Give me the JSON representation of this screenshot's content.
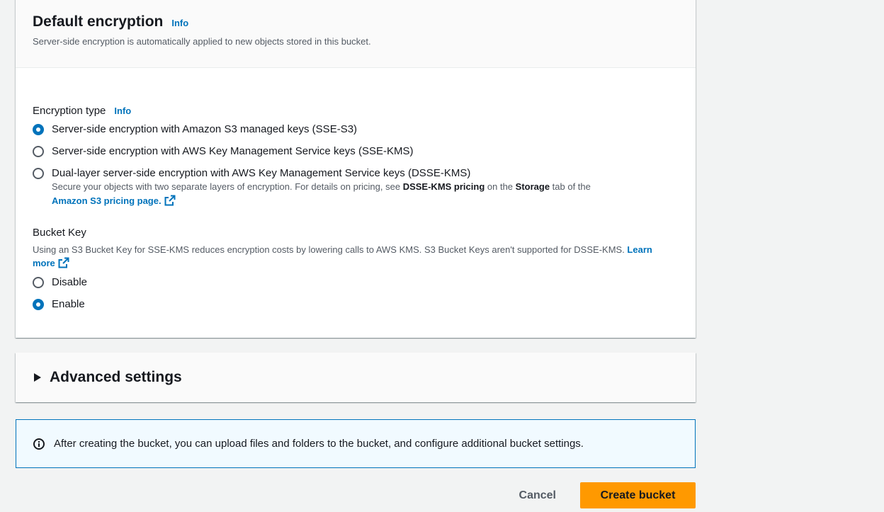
{
  "encryption": {
    "title": "Default encryption",
    "info": "Info",
    "description": "Server-side encryption is automatically applied to new objects stored in this bucket.",
    "type_label": "Encryption type",
    "type_info": "Info",
    "options": [
      {
        "label": "Server-side encryption with Amazon S3 managed keys (SSE-S3)",
        "checked": true
      },
      {
        "label": "Server-side encryption with AWS Key Management Service keys (SSE-KMS)",
        "checked": false
      },
      {
        "label": "Dual-layer server-side encryption with AWS Key Management Service keys (DSSE-KMS)",
        "checked": false
      }
    ],
    "dsse_desc": {
      "part1": "Secure your objects with two separate layers of encryption. For details on pricing, see ",
      "bold1": "DSSE-KMS pricing",
      "part2": " on the ",
      "bold2": "Storage",
      "part3": " tab of the ",
      "link": "Amazon S3 pricing page."
    }
  },
  "bucket_key": {
    "label": "Bucket Key",
    "description": "Using an S3 Bucket Key for SSE-KMS reduces encryption costs by lowering calls to AWS KMS. S3 Bucket Keys aren't supported for DSSE-KMS. ",
    "learn_more": "Learn more",
    "options": [
      {
        "label": "Disable",
        "checked": false
      },
      {
        "label": "Enable",
        "checked": true
      }
    ]
  },
  "advanced": {
    "title": "Advanced settings"
  },
  "alert": {
    "text": "After creating the bucket, you can upload files and folders to the bucket, and configure additional bucket settings."
  },
  "actions": {
    "cancel": "Cancel",
    "create": "Create bucket"
  },
  "colors": {
    "accent": "#0073bb",
    "primary_button": "#ff9900",
    "alert_bg": "#f1faff"
  }
}
